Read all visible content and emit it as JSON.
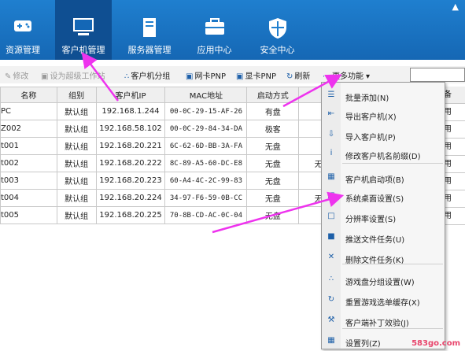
{
  "nav": {
    "items": [
      {
        "label": "资源管理",
        "icon": "gamepad-icon"
      },
      {
        "label": "客户机管理",
        "icon": "monitor-icon"
      },
      {
        "label": "服务器管理",
        "icon": "server-icon"
      },
      {
        "label": "应用中心",
        "icon": "toolbox-icon"
      },
      {
        "label": "安全中心",
        "icon": "shield-icon"
      }
    ],
    "active": "客户机管理"
  },
  "toolbar": {
    "modify": "修改",
    "set_super": "设为超级工作站",
    "group": "客户机分组",
    "nic_pnp": "网卡PNP",
    "gpu_pnp": "显卡PNP",
    "refresh": "刷新",
    "more": "更多功能"
  },
  "table": {
    "headers": [
      "名称",
      "组别",
      "客户机IP",
      "MAC地址",
      "启动方式"
    ],
    "rows": [
      {
        "name": "PC",
        "group": "默认组",
        "ip": "192.168.1.244",
        "mac": "00-0C-29-15-AF-26",
        "boot": "有盘"
      },
      {
        "name": "Z002",
        "group": "默认组",
        "ip": "192.168.58.102",
        "mac": "00-0C-29-84-34-DA",
        "boot": "极客"
      },
      {
        "name": "t001",
        "group": "默认组",
        "ip": "192.168.20.221",
        "mac": "6C-62-6D-BB-3A-FA",
        "boot": "无盘"
      },
      {
        "name": "t002",
        "group": "默认组",
        "ip": "192.168.20.222",
        "mac": "8C-89-A5-60-DC-E8",
        "boot": "无盘"
      },
      {
        "name": "t003",
        "group": "默认组",
        "ip": "192.168.20.223",
        "mac": "60-A4-4C-2C-99-83",
        "boot": "无盘"
      },
      {
        "name": "t004",
        "group": "默认组",
        "ip": "192.168.20.224",
        "mac": "34-97-F6-59-0B-CC",
        "boot": "无盘"
      },
      {
        "name": "t005",
        "group": "默认组",
        "ip": "192.168.20.225",
        "mac": "70-8B-CD-AC-0C-04",
        "boot": "无盘"
      }
    ],
    "right_header": "备",
    "right_cells": [
      "用",
      "用",
      "用",
      "用",
      "用",
      "用",
      "用"
    ],
    "partial_cells": [
      "",
      "",
      "",
      "无",
      "",
      "无",
      ""
    ]
  },
  "menu": {
    "items": [
      {
        "label": "批量添加(N)",
        "icon": "list-icon"
      },
      {
        "label": "导出客户机(X)",
        "icon": "export-icon"
      },
      {
        "label": "导入客户机(P)",
        "icon": "import-icon"
      },
      {
        "label": "修改客户机名前缀(D)",
        "icon": "info-icon"
      },
      {
        "label": "客户机启动项(B)",
        "icon": "boot-icon"
      },
      {
        "label": "系统桌面设置(S)",
        "icon": "desktop-icon"
      },
      {
        "label": "分辨率设置(S)",
        "icon": "resolution-icon"
      },
      {
        "label": "推送文件任务(U)",
        "icon": "folder-icon"
      },
      {
        "label": "删除文件任务(K)",
        "icon": "delete-icon"
      },
      {
        "label": "游戏盘分组设置(W)",
        "icon": "group-icon"
      },
      {
        "label": "重置游戏选单缓存(X)",
        "icon": "reset-icon"
      },
      {
        "label": "客户端补丁效验(J)",
        "icon": "wrench-icon"
      },
      {
        "label": "设置列(Z)",
        "icon": "columns-icon"
      }
    ]
  },
  "watermark": "583go.com"
}
